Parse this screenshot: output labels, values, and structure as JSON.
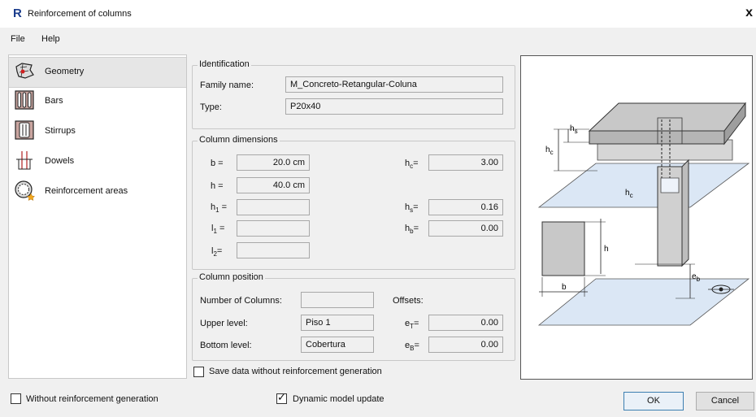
{
  "window": {
    "app_logo": "R",
    "title": "Reinforcement of columns",
    "close_label": "x"
  },
  "menu": {
    "file": "File",
    "help": "Help"
  },
  "nav": {
    "items": [
      {
        "label": "Geometry",
        "icon": "geometry-icon",
        "selected": true
      },
      {
        "label": "Bars",
        "icon": "bars-icon"
      },
      {
        "label": "Stirrups",
        "icon": "stirrups-icon"
      },
      {
        "label": "Dowels",
        "icon": "dowels-icon"
      },
      {
        "label": "Reinforcement areas",
        "icon": "reinforcement-areas-icon"
      }
    ]
  },
  "identification": {
    "legend": "Identification",
    "family_label": "Family name:",
    "family_value": "M_Concreto-Retangular-Coluna",
    "type_label": "Type:",
    "type_value": "P20x40"
  },
  "dimensions": {
    "legend": "Column dimensions",
    "b_label": "b =",
    "b_value": "20.0 cm",
    "h_label": "h =",
    "h_value": "40.0 cm",
    "h1_label": "h",
    "h1_sub": "1",
    "h1_eq": "=",
    "h1_value": "",
    "l1_label": "l",
    "l1_sub": "1",
    "l1_eq": "=",
    "l1_value": "",
    "l2_label": "l",
    "l2_sub": "2",
    "l2_eq": "=",
    "l2_value": "",
    "hc_label": "h",
    "hc_sub": "c",
    "hc_eq": "=",
    "hc_value": "3.00",
    "hs_label": "h",
    "hs_sub": "s",
    "hs_eq": "=",
    "hs_value": "0.16",
    "hb_label": "h",
    "hb_sub": "b",
    "hb_eq": "=",
    "hb_value": "0.00"
  },
  "position": {
    "legend": "Column position",
    "num_columns_label": "Number of Columns:",
    "num_columns_value": "",
    "offsets_label": "Offsets:",
    "upper_label": "Upper level:",
    "upper_value": "Piso 1",
    "bottom_label": "Bottom level:",
    "bottom_value": "Cobertura",
    "et_label": "e",
    "et_sub": "T",
    "et_eq": "=",
    "et_value": "0.00",
    "eb_label": "e",
    "eb_sub": "B",
    "eb_eq": "=",
    "eb_value": "0.00"
  },
  "save_without": {
    "label": "Save data without reinforcement generation",
    "checked": false
  },
  "footer": {
    "without_generation": {
      "label": "Without reinforcement generation",
      "checked": false
    },
    "dynamic_update": {
      "label": "Dynamic model update",
      "checked": true,
      "mark": "✓"
    },
    "ok_label": "OK",
    "cancel_label": "Cancel"
  },
  "diagram": {
    "hs": "h",
    "hs_sub": "s",
    "hc": "h",
    "hc_sub": "c",
    "hc2": "h",
    "hc2_sub": "c",
    "h": "h",
    "b": "b",
    "eb": "e",
    "eb_sub": "b"
  },
  "colors": {
    "accent": "#1a3c8c",
    "slab_fill": "#c8c8c8",
    "plane_fill": "#dbe7f5"
  }
}
